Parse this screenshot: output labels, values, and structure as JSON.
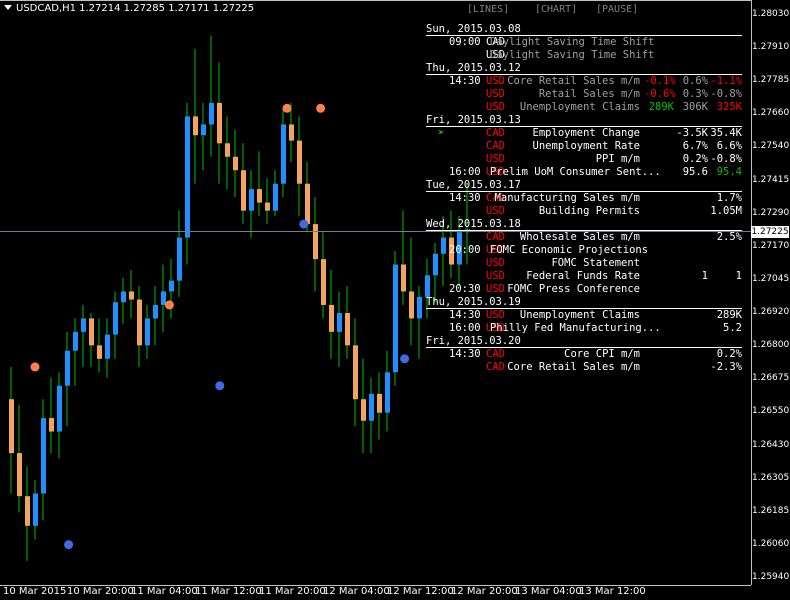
{
  "symbol_title": "USDCAD,H1  1.27214 1.27285 1.27171 1.27225",
  "current_price": "1.27225",
  "toolbar": {
    "lines": "[LINES]",
    "chart": "[CHART]",
    "pause": "[PAUSE]"
  },
  "price_axis": [
    "1.28030",
    "1.27910",
    "1.27785",
    "1.27660",
    "1.27540",
    "1.27415",
    "1.27290",
    "1.27170",
    "1.27045",
    "1.26920",
    "1.26800",
    "1.26675",
    "1.26550",
    "1.26430",
    "1.26305",
    "1.26185",
    "1.26060",
    "1.25940"
  ],
  "time_axis": [
    "10 Mar 2015",
    "10 Mar 20:00",
    "11 Mar 04:00",
    "11 Mar 12:00",
    "11 Mar 20:00",
    "12 Mar 04:00",
    "12 Mar 12:00",
    "12 Mar 20:00",
    "13 Mar 04:00",
    "13 Mar 12:00"
  ],
  "colors": {
    "bull": "#1e90ff",
    "bear": "#f4a460",
    "wick": "#00c000",
    "dot_up": "#ff7f50",
    "dot_down": "#4169e1",
    "red": "#ff0000",
    "green": "#00c000",
    "gray": "#a0a0a0"
  },
  "calendar": [
    {
      "date": "Sun, 2015.03.08",
      "events": [
        {
          "time": "09:00",
          "cur": "CAD",
          "cur_color": "#ffffff",
          "name": "Daylight Saving Time Shift",
          "name_color": "#a0a0a0",
          "a": "",
          "f": "",
          "p": "",
          "ac": "#fff",
          "fc": "#fff",
          "pc": "#fff"
        },
        {
          "time": "",
          "cur": "USD",
          "cur_color": "#ffffff",
          "name": "Daylight Saving Time Shift",
          "name_color": "#a0a0a0",
          "a": "",
          "f": "",
          "p": "",
          "ac": "#fff",
          "fc": "#fff",
          "pc": "#fff"
        }
      ]
    },
    {
      "date": "Thu, 2015.03.12",
      "events": [
        {
          "time": "14:30",
          "cur": "USD",
          "cur_color": "#ff0000",
          "name": "Core Retail Sales m/m",
          "name_color": "#a0a0a0",
          "a": "-0.1%",
          "f": "0.6%",
          "p": "-1.1%",
          "ac": "#ff0000",
          "fc": "#a0a0a0",
          "pc": "#ff0000"
        },
        {
          "time": "",
          "cur": "USD",
          "cur_color": "#ff0000",
          "name": "Retail Sales m/m",
          "name_color": "#a0a0a0",
          "a": "-0.6%",
          "f": "0.3%",
          "p": "-0.8%",
          "ac": "#ff0000",
          "fc": "#a0a0a0",
          "pc": "#a0a0a0"
        },
        {
          "time": "",
          "cur": "USD",
          "cur_color": "#ff0000",
          "name": "Unemployment Claims",
          "name_color": "#a0a0a0",
          "a": "289K",
          "f": "306K",
          "p": "325K",
          "ac": "#00c000",
          "fc": "#a0a0a0",
          "pc": "#ff0000"
        }
      ]
    },
    {
      "date": "Fri, 2015.03.13",
      "events": [
        {
          "time": "",
          "cur": "CAD",
          "cur_color": "#ff0000",
          "name": "Employment Change",
          "name_color": "#ffffff",
          "a": "",
          "f": "-3.5K",
          "p": "35.4K",
          "ac": "#fff",
          "fc": "#fff",
          "pc": "#fff",
          "arrow": true
        },
        {
          "time": "",
          "cur": "CAD",
          "cur_color": "#ff0000",
          "name": "Unemployment Rate",
          "name_color": "#ffffff",
          "a": "",
          "f": "6.7%",
          "p": "6.6%",
          "ac": "#fff",
          "fc": "#fff",
          "pc": "#fff"
        },
        {
          "time": "",
          "cur": "USD",
          "cur_color": "#ff0000",
          "name": "PPI m/m",
          "name_color": "#ffffff",
          "a": "",
          "f": "0.2%",
          "p": "-0.8%",
          "ac": "#fff",
          "fc": "#fff",
          "pc": "#fff"
        },
        {
          "time": "16:00",
          "cur": "USD",
          "cur_color": "#ff0000",
          "name": "Prelim UoM Consumer Sent...",
          "name_color": "#ffffff",
          "a": "",
          "f": "95.6",
          "p": "95.4",
          "ac": "#fff",
          "fc": "#fff",
          "pc": "#00c000"
        }
      ]
    },
    {
      "date": "Tue, 2015.03.17",
      "events": [
        {
          "time": "14:30",
          "cur": "CAD",
          "cur_color": "#ff0000",
          "name": "Manufacturing Sales m/m",
          "name_color": "#ffffff",
          "a": "",
          "f": "",
          "p": "1.7%",
          "ac": "#fff",
          "fc": "#fff",
          "pc": "#fff"
        },
        {
          "time": "",
          "cur": "USD",
          "cur_color": "#ff0000",
          "name": "Building Permits",
          "name_color": "#ffffff",
          "a": "",
          "f": "",
          "p": "1.05M",
          "ac": "#fff",
          "fc": "#fff",
          "pc": "#fff"
        }
      ]
    },
    {
      "date": "Wed, 2015.03.18",
      "events": [
        {
          "time": "",
          "cur": "CAD",
          "cur_color": "#ff0000",
          "name": "Wholesale Sales m/m",
          "name_color": "#ffffff",
          "a": "",
          "f": "",
          "p": "2.5%",
          "ac": "#fff",
          "fc": "#fff",
          "pc": "#fff"
        },
        {
          "time": "20:00",
          "cur": "USD",
          "cur_color": "#ff0000",
          "name": "FOMC Economic Projections",
          "name_color": "#ffffff",
          "a": "",
          "f": "",
          "p": "",
          "ac": "#fff",
          "fc": "#fff",
          "pc": "#fff"
        },
        {
          "time": "",
          "cur": "USD",
          "cur_color": "#ff0000",
          "name": "FOMC Statement",
          "name_color": "#ffffff",
          "a": "",
          "f": "",
          "p": "",
          "ac": "#fff",
          "fc": "#fff",
          "pc": "#fff"
        },
        {
          "time": "",
          "cur": "USD",
          "cur_color": "#ff0000",
          "name": "Federal Funds Rate",
          "name_color": "#ffffff",
          "a": "",
          "f": "1",
          "p": "1",
          "ac": "#fff",
          "fc": "#fff",
          "pc": "#fff"
        },
        {
          "time": "20:30",
          "cur": "USD",
          "cur_color": "#ff0000",
          "name": "FOMC Press Conference",
          "name_color": "#ffffff",
          "a": "",
          "f": "",
          "p": "",
          "ac": "#fff",
          "fc": "#fff",
          "pc": "#fff"
        }
      ]
    },
    {
      "date": "Thu, 2015.03.19",
      "events": [
        {
          "time": "14:30",
          "cur": "USD",
          "cur_color": "#ff0000",
          "name": "Unemployment Claims",
          "name_color": "#ffffff",
          "a": "",
          "f": "",
          "p": "289K",
          "ac": "#fff",
          "fc": "#fff",
          "pc": "#fff"
        },
        {
          "time": "16:00",
          "cur": "USD",
          "cur_color": "#ff0000",
          "name": "Philly Fed Manufacturing...",
          "name_color": "#ffffff",
          "a": "",
          "f": "",
          "p": "5.2",
          "ac": "#fff",
          "fc": "#fff",
          "pc": "#fff"
        }
      ]
    },
    {
      "date": "Fri, 2015.03.20",
      "events": [
        {
          "time": "14:30",
          "cur": "CAD",
          "cur_color": "#ff0000",
          "name": "Core CPI m/m",
          "name_color": "#ffffff",
          "a": "",
          "f": "",
          "p": "0.2%",
          "ac": "#fff",
          "fc": "#fff",
          "pc": "#fff"
        },
        {
          "time": "",
          "cur": "CAD",
          "cur_color": "#ff0000",
          "name": "Core Retail Sales m/m",
          "name_color": "#ffffff",
          "a": "",
          "f": "",
          "p": "-2.3%",
          "ac": "#fff",
          "fc": "#fff",
          "pc": "#fff"
        }
      ]
    }
  ],
  "chart_data": {
    "type": "candlestick",
    "ylim": [
      1.2594,
      1.2803
    ],
    "candles": [
      [
        1.266,
        1.2672,
        1.2625,
        1.264
      ],
      [
        1.264,
        1.2658,
        1.2618,
        1.2624
      ],
      [
        1.2624,
        1.2635,
        1.26,
        1.2613
      ],
      [
        1.2613,
        1.263,
        1.2608,
        1.2625
      ],
      [
        1.2625,
        1.266,
        1.2615,
        1.2653
      ],
      [
        1.2653,
        1.2668,
        1.264,
        1.2648
      ],
      [
        1.2648,
        1.267,
        1.2638,
        1.2665
      ],
      [
        1.2665,
        1.2685,
        1.265,
        1.2678
      ],
      [
        1.2678,
        1.269,
        1.2665,
        1.2685
      ],
      [
        1.2685,
        1.2695,
        1.2672,
        1.269
      ],
      [
        1.269,
        1.2692,
        1.2672,
        1.268
      ],
      [
        1.268,
        1.269,
        1.267,
        1.2675
      ],
      [
        1.2675,
        1.269,
        1.2668,
        1.2684
      ],
      [
        1.2684,
        1.27,
        1.2675,
        1.2696
      ],
      [
        1.2696,
        1.2705,
        1.2688,
        1.27
      ],
      [
        1.27,
        1.2708,
        1.269,
        1.2697
      ],
      [
        1.2697,
        1.2702,
        1.2672,
        1.268
      ],
      [
        1.268,
        1.2695,
        1.2675,
        1.269
      ],
      [
        1.269,
        1.2702,
        1.268,
        1.2695
      ],
      [
        1.2695,
        1.271,
        1.2685,
        1.27
      ],
      [
        1.27,
        1.2712,
        1.269,
        1.2704
      ],
      [
        1.2704,
        1.273,
        1.2698,
        1.272
      ],
      [
        1.272,
        1.277,
        1.271,
        1.2765
      ],
      [
        1.2765,
        1.279,
        1.274,
        1.2758
      ],
      [
        1.2758,
        1.277,
        1.2745,
        1.2762
      ],
      [
        1.2762,
        1.2795,
        1.275,
        1.277
      ],
      [
        1.277,
        1.2785,
        1.274,
        1.2755
      ],
      [
        1.2755,
        1.2765,
        1.2738,
        1.275
      ],
      [
        1.275,
        1.276,
        1.2735,
        1.2745
      ],
      [
        1.2745,
        1.2755,
        1.2725,
        1.273
      ],
      [
        1.273,
        1.2745,
        1.272,
        1.2738
      ],
      [
        1.2738,
        1.2752,
        1.2728,
        1.2733
      ],
      [
        1.2733,
        1.2742,
        1.2725,
        1.273
      ],
      [
        1.273,
        1.2745,
        1.2728,
        1.274
      ],
      [
        1.274,
        1.2768,
        1.2735,
        1.2762
      ],
      [
        1.2762,
        1.277,
        1.2748,
        1.2756
      ],
      [
        1.2756,
        1.2765,
        1.2728,
        1.274
      ],
      [
        1.274,
        1.2748,
        1.2722,
        1.2725
      ],
      [
        1.2725,
        1.2735,
        1.27,
        1.2712
      ],
      [
        1.2712,
        1.2722,
        1.269,
        1.2695
      ],
      [
        1.2695,
        1.2708,
        1.2675,
        1.2685
      ],
      [
        1.2685,
        1.27,
        1.2672,
        1.2692
      ],
      [
        1.2692,
        1.2702,
        1.2675,
        1.268
      ],
      [
        1.268,
        1.269,
        1.265,
        1.266
      ],
      [
        1.266,
        1.2675,
        1.264,
        1.2652
      ],
      [
        1.2652,
        1.2668,
        1.264,
        1.2662
      ],
      [
        1.2662,
        1.267,
        1.2645,
        1.2655
      ],
      [
        1.2655,
        1.2678,
        1.2648,
        1.267
      ],
      [
        1.267,
        1.2715,
        1.2665,
        1.271
      ],
      [
        1.271,
        1.273,
        1.2695,
        1.27
      ],
      [
        1.27,
        1.272,
        1.268,
        1.269
      ],
      [
        1.269,
        1.2702,
        1.2675,
        1.2698
      ],
      [
        1.2698,
        1.2712,
        1.269,
        1.2706
      ],
      [
        1.2706,
        1.2718,
        1.2696,
        1.2714
      ],
      [
        1.2714,
        1.2728,
        1.2702,
        1.272
      ],
      [
        1.272,
        1.273,
        1.2705,
        1.271
      ],
      [
        1.271,
        1.2728,
        1.2702,
        1.2722
      ],
      [
        1.2722,
        1.274,
        1.271,
        1.2723
      ]
    ],
    "fractals_up": [
      [
        0,
        1.2672
      ],
      [
        8,
        1.2695
      ],
      [
        15,
        1.2768
      ],
      [
        17,
        1.2768
      ]
    ],
    "fractals_down": [
      [
        2,
        1.2606
      ],
      [
        11,
        1.2665
      ],
      [
        16,
        1.2725
      ],
      [
        22,
        1.2675
      ]
    ]
  }
}
